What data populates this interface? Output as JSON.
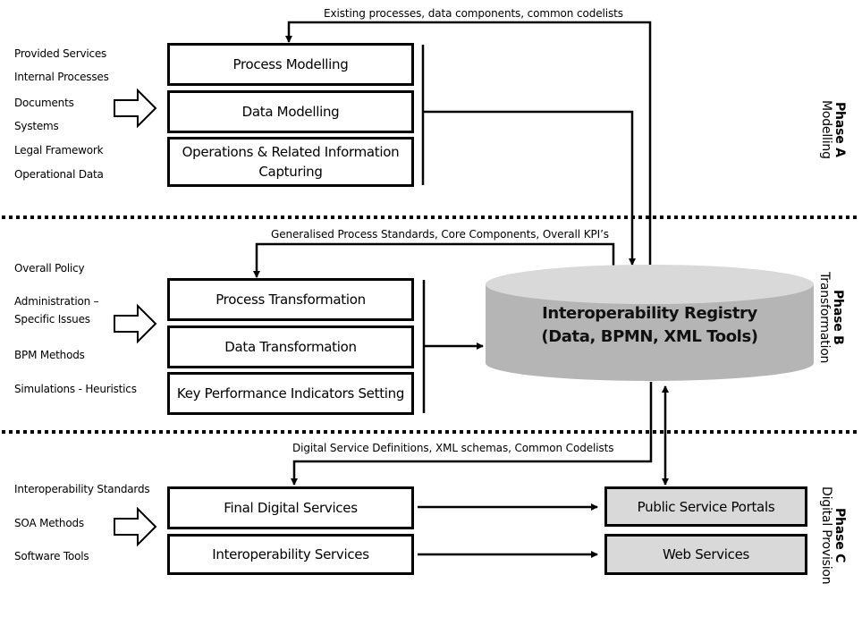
{
  "phase_a": {
    "title": "Phase A",
    "subtitle": "Modelling",
    "inputs": [
      "Provided Services",
      "Internal Processes",
      "Documents",
      "Systems",
      "Legal Framework",
      "Operational Data"
    ],
    "boxes": [
      "Process Modelling",
      "Data Modelling",
      "Operations & Related Information Capturing"
    ],
    "feedback": "Existing processes, data components,  common codelists"
  },
  "phase_b": {
    "title": "Phase B",
    "subtitle": "Transformation",
    "inputs": [
      "Overall Policy",
      "Administration  –",
      "Specific Issues",
      "BPM Methods",
      "Simulations   - Heuristics"
    ],
    "boxes": [
      "Process Transformation",
      "Data Transformation",
      "Key Performance Indicators Setting"
    ],
    "feedback": "Generalised Process Standards,  Core Components,  Overall KPI’s"
  },
  "phase_c": {
    "title": "Phase C",
    "subtitle": "Digital Provision",
    "inputs": [
      "Interoperability  Standards",
      "SOA Methods",
      "Software Tools"
    ],
    "boxes": [
      "Final Digital Services",
      "Interoperability Services"
    ],
    "outputs": [
      "Public Service Portals",
      "Web Services"
    ],
    "feedback": "Digital Service Definitions,  XML schemas,  Common Codelists"
  },
  "registry": {
    "line1": "Interoperability Registry",
    "line2": "(Data, BPMN, XML Tools)"
  },
  "colors": {
    "stroke": "#000000",
    "cylinder_top": "#d9d9d9",
    "cylinder_body": "#b5b5b5",
    "output_box": "#d9d9d9"
  }
}
